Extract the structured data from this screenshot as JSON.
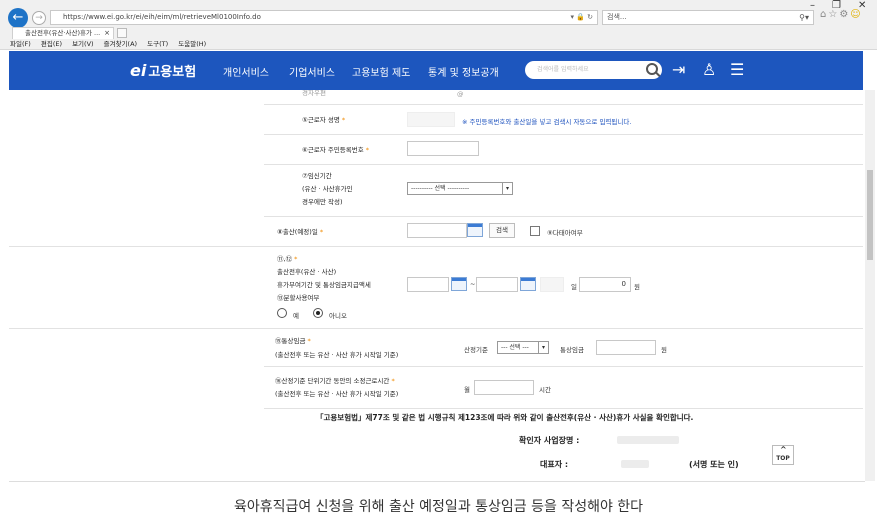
{
  "browser": {
    "url": "https://www.ei.go.kr/ei/eih/eim/ml/retrieveMl0100Info.do",
    "search_placeholder": "검색...",
    "tab_title": "출산전후(유산·사산)휴가 ...",
    "menu": [
      "파일(F)",
      "편집(E)",
      "보기(V)",
      "즐겨찾기(A)",
      "도구(T)",
      "도움말(H)"
    ]
  },
  "site": {
    "logo": "고용보험",
    "nav": [
      "개인서비스",
      "기업서비스",
      "고용보험 제도",
      "통계 및 정보공개"
    ],
    "search_placeholder": "검색어를 입력하세요"
  },
  "form": {
    "rows": {
      "top_cut": "경자우편",
      "name_label": "⑤근로자 성명",
      "name_hint": "※ 주민등록번호와 출산일을 넣고 검색시 자동으로 입력됩니다.",
      "rrn_label": "⑥근로자 주민등록번호",
      "preg_label_1": "⑦임신기간",
      "preg_label_2": "(유산 · 사산휴가인",
      "preg_label_3": "경우에만 작성)",
      "preg_select": "---------- 선택 ----------",
      "birth_label": "⑧출산(예정)일",
      "search_btn": "검색",
      "multi_label": "⑨다태아여부",
      "period_label_1": "⑪,⑫",
      "period_label_2": "출산전후(유산 · 사산)",
      "period_label_3": "휴가부여기간 및 통상임금지급액세",
      "period_label_4": "⑬분할사용여부",
      "dash": "~",
      "day_unit": "일",
      "amount": "0",
      "won": "원",
      "radio_yes": "예",
      "radio_no": "아니오",
      "wage_label_1": "⑮통상임금",
      "wage_label_2": "(출산전후 또는 유산 · 사산 휴가 시작일 기준)",
      "wage_base": "산정기준",
      "wage_select": "--- 선택 ---",
      "wage_normal": "통상임금",
      "wage_won": "원",
      "hours_label_1": "⑯산정기준 단위기간 동안의 소정근로시간",
      "hours_label_2": "(출산전후 또는 유산 · 사산 휴가 시작일 기준)",
      "hours_month": "월",
      "hours_unit": "시간"
    },
    "statement": "「고용보험법」제77조 및 같은 법 시행규칙 제123조에 따라 위와 같이 출산전후(유산 · 사산)휴가 사실을 확인합니다.",
    "confirm_label": "확인자 사업장명 :",
    "rep_label": "대표자 :",
    "sign_label": "(서명 또는 인)",
    "top_button": "TOP"
  },
  "caption": "육아휴직급여 신청을 위해 출산 예정일과 통상임금 등을 작성해야 한다"
}
